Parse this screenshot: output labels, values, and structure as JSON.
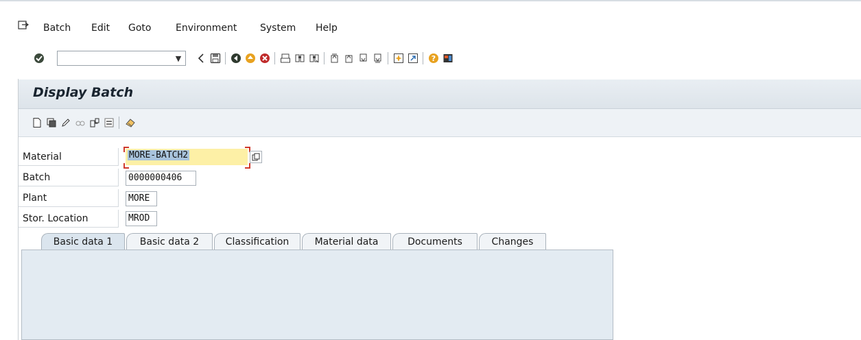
{
  "menu": {
    "items": [
      {
        "label": "Batch"
      },
      {
        "label": "Edit"
      },
      {
        "label": "Goto"
      },
      {
        "label": "Environment"
      },
      {
        "label": "System"
      },
      {
        "label": "Help"
      }
    ]
  },
  "toolbar": {
    "command_field_value": "",
    "icons": [
      "enter-icon",
      "back-nav-icon",
      "save-icon",
      "back-icon",
      "exit-icon",
      "cancel-icon",
      "print-icon",
      "find-icon",
      "find-next-icon",
      "first-page-icon",
      "previous-page-icon",
      "next-page-icon",
      "last-page-icon",
      "create-session-icon",
      "shortcut-icon",
      "help-icon",
      "customize-layout-icon"
    ]
  },
  "page": {
    "title": "Display Batch"
  },
  "form": {
    "material_label": "Material",
    "material_value": "MORE-BATCH2",
    "batch_label": "Batch",
    "batch_value": "0000000406",
    "plant_label": "Plant",
    "plant_value": "MORE",
    "storloc_label": "Stor. Location",
    "storloc_value": "MROD"
  },
  "tabs": [
    {
      "label": "Basic data 1",
      "active": true
    },
    {
      "label": "Basic data 2",
      "active": false
    },
    {
      "label": "Classification",
      "active": false
    },
    {
      "label": "Material data",
      "active": false
    },
    {
      "label": "Documents",
      "active": false
    },
    {
      "label": "Changes",
      "active": false
    }
  ],
  "colors": {
    "title_bar": "#dde4ea",
    "material_field_bg": "#fdf0a6",
    "selection": "#a8c3dc",
    "tab_panel": "#e3ebf2"
  }
}
